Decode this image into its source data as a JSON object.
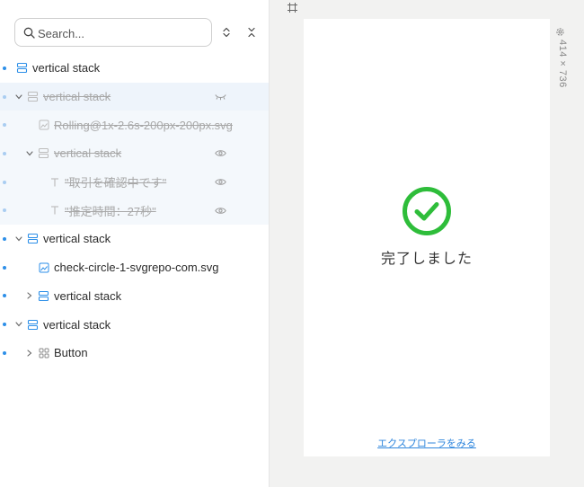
{
  "search": {
    "placeholder": "Search..."
  },
  "layers": [
    {
      "label": "vertical stack",
      "icon": "stack-icon",
      "hidden": false,
      "indent": 0,
      "caret": "none"
    },
    {
      "label": "vertical stack",
      "icon": "stack-icon",
      "hidden": true,
      "indent": 0,
      "caret": "down",
      "eye": "eye-closed-icon"
    },
    {
      "label": "Rolling@1x-2.6s-200px-200px.svg",
      "icon": "image-icon",
      "hidden": true,
      "indent": 1,
      "caret": "none"
    },
    {
      "label": "vertical stack",
      "icon": "stack-icon",
      "hidden": true,
      "indent": 1,
      "caret": "down",
      "eye": "eye-icon"
    },
    {
      "label": "\"取引を確認中です\"",
      "icon": "text-icon",
      "hidden": true,
      "indent": 2,
      "caret": "none",
      "eye": "eye-icon"
    },
    {
      "label": "\"推定時間：27秒\"",
      "icon": "text-icon",
      "hidden": true,
      "indent": 2,
      "caret": "none",
      "eye": "eye-icon"
    },
    {
      "label": "vertical stack",
      "icon": "stack-icon",
      "hidden": false,
      "indent": 0,
      "caret": "down"
    },
    {
      "label": "check-circle-1-svgrepo-com.svg",
      "icon": "image-icon",
      "hidden": false,
      "indent": 1,
      "caret": "none"
    },
    {
      "label": "vertical stack",
      "icon": "stack-icon",
      "hidden": false,
      "indent": 1,
      "caret": "right"
    },
    {
      "label": "vertical stack",
      "icon": "stack-icon",
      "hidden": false,
      "indent": 0,
      "caret": "down"
    },
    {
      "label": "Button",
      "icon": "component-icon",
      "hidden": false,
      "indent": 1,
      "caret": "right"
    }
  ],
  "canvas": {
    "done_text": "完了しました",
    "link_text": "エクスプローラをみる",
    "size_readout": "414 × 736",
    "check_color": "#2ebd3a",
    "link_color": "#2f86dd"
  }
}
